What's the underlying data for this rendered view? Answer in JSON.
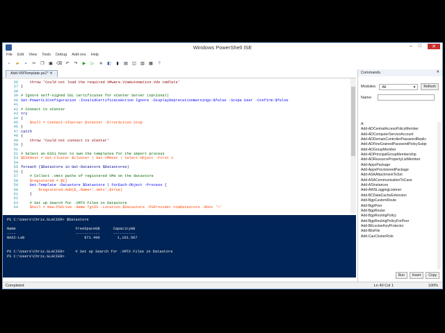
{
  "window": {
    "title": "Windows PowerShell ISE",
    "min": "–",
    "max": "□",
    "close": "✕"
  },
  "menu": [
    "File",
    "Edit",
    "View",
    "Tools",
    "Debug",
    "Add-ons",
    "Help"
  ],
  "toolbar_icons": [
    "new-icon",
    "open-icon",
    "save-icon",
    "cut-icon",
    "copy-icon",
    "paste-icon",
    "clear-icon",
    "undo-icon",
    "redo-icon",
    "run-icon",
    "run-selection-icon",
    "stop-icon",
    "remote-icon",
    "console-icon",
    "layout-icon",
    "layout2-icon",
    "layout3-icon",
    "show-cmd-icon",
    "help-icon"
  ],
  "tab": {
    "label": "Add-VMTemplate.ps1*",
    "close": "✕"
  },
  "editor": {
    "lines": [
      {
        "n": "36",
        "t": "    throw 'Could not load the required VMware.VimAutomation.Vds cmdlets'"
      },
      {
        "n": "37",
        "t": "}"
      },
      {
        "n": "38",
        "t": ""
      },
      {
        "n": "39",
        "t": "# Ignore self-signed SSL certificates for vCenter Server (optional)"
      },
      {
        "n": "40",
        "t": "Set-PowerCLIConfiguration -InvalidCertificateAction Ignore -DisplayDeprecationWarnings:$false -Scope User -Confirm:$false"
      },
      {
        "n": "41",
        "t": ""
      },
      {
        "n": "42",
        "t": "# Connect to vCenter"
      },
      {
        "n": "43",
        "t": "try"
      },
      {
        "n": "44",
        "t": "{"
      },
      {
        "n": "45",
        "t": "    $null = Connect-VIServer $vcenter -ErrorAction Stop"
      },
      {
        "n": "46",
        "t": "}"
      },
      {
        "n": "47",
        "t": "catch"
      },
      {
        "n": "48",
        "t": "{"
      },
      {
        "n": "49",
        "t": "    throw 'Could not connect to vCenter'"
      },
      {
        "n": "50",
        "t": "}"
      },
      {
        "n": "51",
        "t": ""
      },
      {
        "n": "52",
        "t": "# Select an ESXi host to own the templates for the import process"
      },
      {
        "n": "53",
        "t": "$ESXHost = Get-Cluster $cluster | Get-VMHost | Select-Object -First 1"
      },
      {
        "n": "54",
        "t": ""
      },
      {
        "n": "55",
        "t": "foreach ($Datastore in Get-Datastore $Datastores)"
      },
      {
        "n": "56",
        "t": "{"
      },
      {
        "n": "57",
        "t": "    # Collect .vmtx paths of registered VMs on the datastore"
      },
      {
        "n": "58",
        "t": "    $registered = @{}"
      },
      {
        "n": "59",
        "t": "    Get-Template -Datastore $Datastore | ForEach-Object -Process {"
      },
      {
        "n": "60",
        "t": "        $registered.Add($_.Name+'.vmtx',$true)"
      },
      {
        "n": "61",
        "t": "    }"
      },
      {
        "n": "62",
        "t": ""
      },
      {
        "n": "63",
        "t": "    # Set up Search for .VMTX Files in Datastore"
      },
      {
        "n": "64",
        "t": "    $null = New-PSDrive -Name TgtDS -Location $Datastore -PSProvider VimDatastore -Root '\\'"
      }
    ]
  },
  "console": {
    "lines": [
      "PS C:\\Users\\Chris.GLACIER> $Datastore",
      "",
      "Name                           FreeSpaceGB      CapacityGB",
      "----                           -----------      ----------",
      "NAS2-Lab                           871.490        1,161.507",
      "",
      "",
      "PS C:\\Users\\Chris.GLACIER>     # Set up Search for .VMTX Files in Datastore",
      "PS C:\\Users\\Chris.GLACIER>"
    ]
  },
  "commands": {
    "title": "Commands",
    "close": "✕",
    "modules_label": "Modules:",
    "modules_value": "All",
    "refresh": "Refresh",
    "name_label": "Name:",
    "items": [
      "A:",
      "Add-ADCentralAccessPolicyMember",
      "Add-ADComputerServiceAccount",
      "Add-ADDomainControllerPasswordReplic",
      "Add-ADFineGrainedPasswordPolicySubje",
      "Add-ADGroupMember",
      "Add-ADPrincipalGroupMembership",
      "Add-ADResourcePropertyListMember",
      "Add-AppxPackage",
      "Add-AppxProvisionedPackage",
      "Add-ASAAttachmentToSet",
      "Add-ASACommunicationToCase",
      "Add-ASInstances",
      "Add-AWSLoggingListener",
      "Add-BCDataCacheExtension",
      "Add-BgpCustomRoute",
      "Add-BgpPeer",
      "Add-BgpRouter",
      "Add-BgpRoutingPolicy",
      "Add-BgpRoutingPolicyForPeer",
      "Add-BitLockerKeyProtector",
      "Add-BitsFile",
      "Add-CauClusterRole"
    ],
    "run": "Run",
    "insert": "Insert",
    "copy": "Copy"
  },
  "status": {
    "text": "Completed",
    "position": "Ln 40  Col 1",
    "zoom": "100%"
  }
}
